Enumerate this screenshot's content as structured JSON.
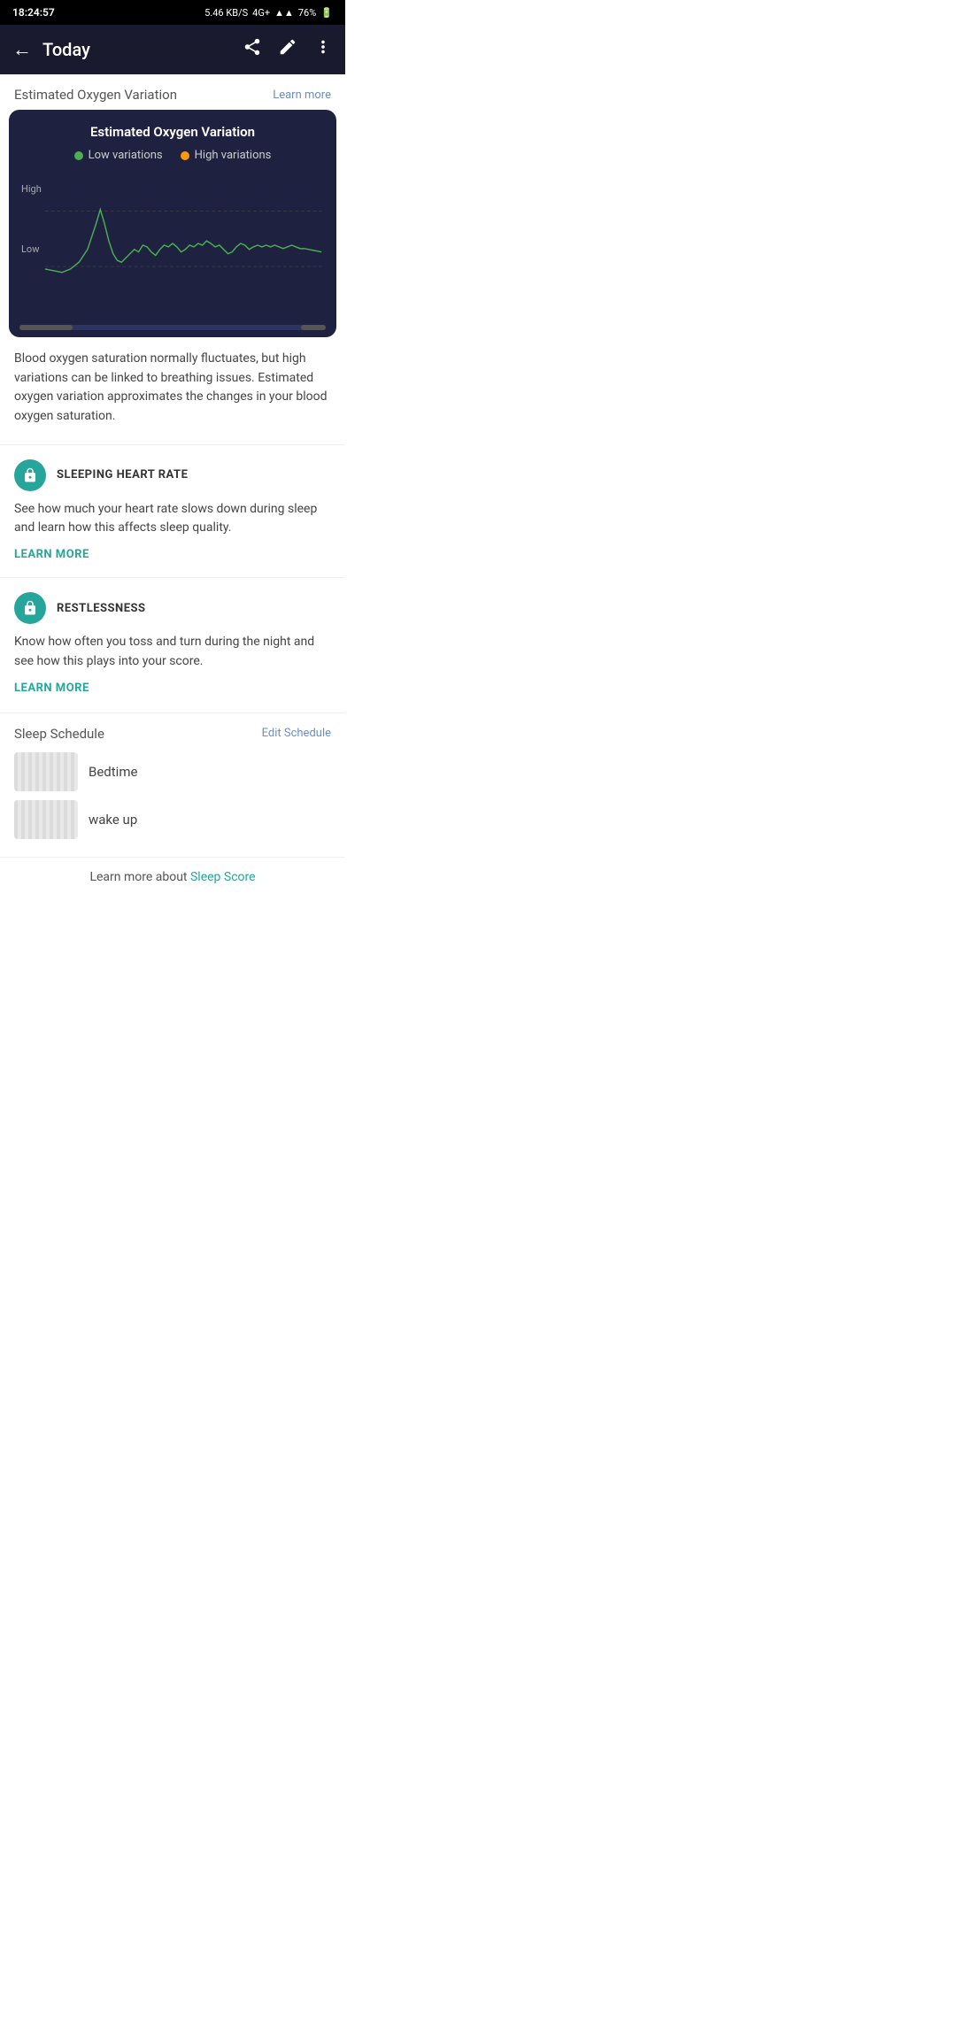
{
  "statusBar": {
    "time": "18:24:57",
    "network": "5.46 KB/S",
    "networkType": "4G+",
    "battery": "76%"
  },
  "appBar": {
    "title": "Today",
    "shareIcon": "share",
    "editIcon": "edit",
    "moreIcon": "more_vert"
  },
  "oxygenSection": {
    "title": "Estimated Oxygen Variation",
    "learnMoreLabel": "Learn more",
    "chartTitle": "Estimated Oxygen Variation",
    "legendLowLabel": "Low variations",
    "legendHighLabel": "High variations",
    "chartHighLabel": "High",
    "chartLowLabel": "Low",
    "description": "Blood oxygen saturation normally fluctuates, but high variations can be linked to breathing issues. Estimated oxygen variation approximates the changes in your blood oxygen saturation."
  },
  "sleepingHeartRate": {
    "iconLabel": "lock-icon",
    "featureLabel": "SLEEPING HEART RATE",
    "description": "See how much your heart rate slows down during sleep and learn how this affects sleep quality.",
    "learnMoreLabel": "LEARN MORE"
  },
  "restlessness": {
    "iconLabel": "lock-icon",
    "featureLabel": "RESTLESSNESS",
    "description": "Know how often you toss and turn during the night and see how this plays into your score.",
    "learnMoreLabel": "LEARN MORE"
  },
  "sleepSchedule": {
    "title": "Sleep Schedule",
    "editLabel": "Edit Schedule",
    "bedtimeLabel": "Bedtime",
    "wakeUpLabel": "wake up"
  },
  "bottomBar": {
    "prefixText": "Learn more about",
    "linkText": "Sleep Score"
  }
}
